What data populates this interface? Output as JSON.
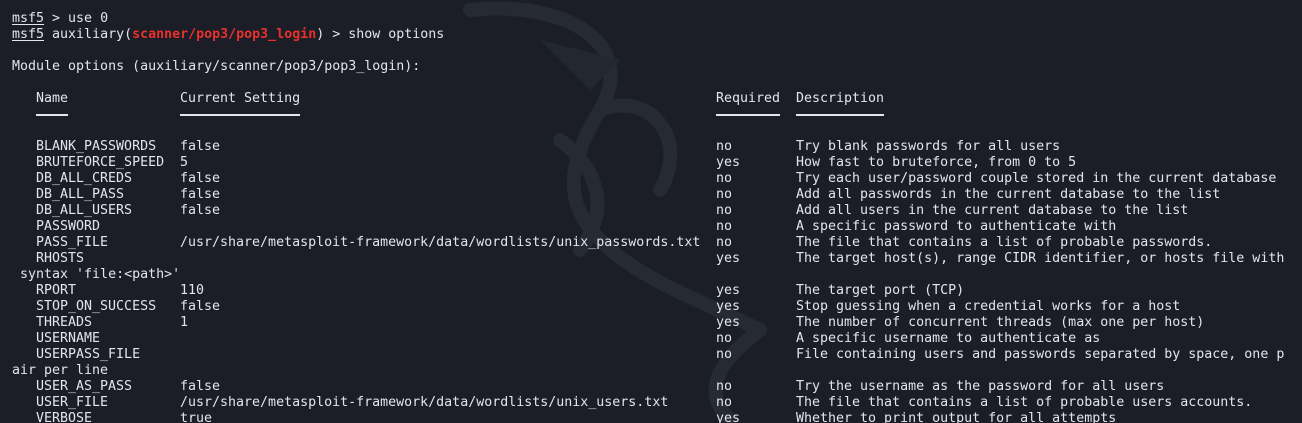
{
  "prompt": {
    "name": "msf5",
    "line1_text": " > use 0",
    "line2_prefix": " auxiliary(",
    "module": "scanner/pop3/pop3_login",
    "line2_suffix": ") > show options"
  },
  "heading": "Module options (auxiliary/scanner/pop3/pop3_login):",
  "table": {
    "headers": {
      "name": "Name",
      "setting": "Current Setting",
      "required": "Required",
      "description": "Description"
    },
    "rows": [
      {
        "name": "BLANK_PASSWORDS",
        "setting": "false",
        "required": "no",
        "description": "Try blank passwords for all users"
      },
      {
        "name": "BRUTEFORCE_SPEED",
        "setting": "5",
        "required": "yes",
        "description": "How fast to bruteforce, from 0 to 5"
      },
      {
        "name": "DB_ALL_CREDS",
        "setting": "false",
        "required": "no",
        "description": "Try each user/password couple stored in the current database"
      },
      {
        "name": "DB_ALL_PASS",
        "setting": "false",
        "required": "no",
        "description": "Add all passwords in the current database to the list"
      },
      {
        "name": "DB_ALL_USERS",
        "setting": "false",
        "required": "no",
        "description": "Add all users in the current database to the list"
      },
      {
        "name": "PASSWORD",
        "setting": "",
        "required": "no",
        "description": "A specific password to authenticate with"
      },
      {
        "name": "PASS_FILE",
        "setting": "/usr/share/metasploit-framework/data/wordlists/unix_passwords.txt",
        "required": "no",
        "description": "The file that contains a list of probable passwords."
      },
      {
        "name": "RHOSTS",
        "setting": "",
        "required": "yes",
        "description": "The target host(s), range CIDR identifier, or hosts file with",
        "wrap": " syntax 'file:<path>'"
      },
      {
        "name": "RPORT",
        "setting": "110",
        "required": "yes",
        "description": "The target port (TCP)"
      },
      {
        "name": "STOP_ON_SUCCESS",
        "setting": "false",
        "required": "yes",
        "description": "Stop guessing when a credential works for a host"
      },
      {
        "name": "THREADS",
        "setting": "1",
        "required": "yes",
        "description": "The number of concurrent threads (max one per host)"
      },
      {
        "name": "USERNAME",
        "setting": "",
        "required": "no",
        "description": "A specific username to authenticate as"
      },
      {
        "name": "USERPASS_FILE",
        "setting": "",
        "required": "no",
        "description": "File containing users and passwords separated by space, one p",
        "wrap": "air per line"
      },
      {
        "name": "USER_AS_PASS",
        "setting": "false",
        "required": "no",
        "description": "Try the username as the password for all users"
      },
      {
        "name": "USER_FILE",
        "setting": "/usr/share/metasploit-framework/data/wordlists/unix_users.txt",
        "required": "no",
        "description": "The file that contains a list of probable users accounts."
      },
      {
        "name": "VERBOSE",
        "setting": "true",
        "required": "yes",
        "description": "Whether to print output for all attempts"
      }
    ]
  },
  "colors": {
    "background": "#1b1e26",
    "foreground": "#e3e5ea",
    "module": "#e8312b"
  },
  "icons": [
    "kali-dragon-watermark"
  ]
}
